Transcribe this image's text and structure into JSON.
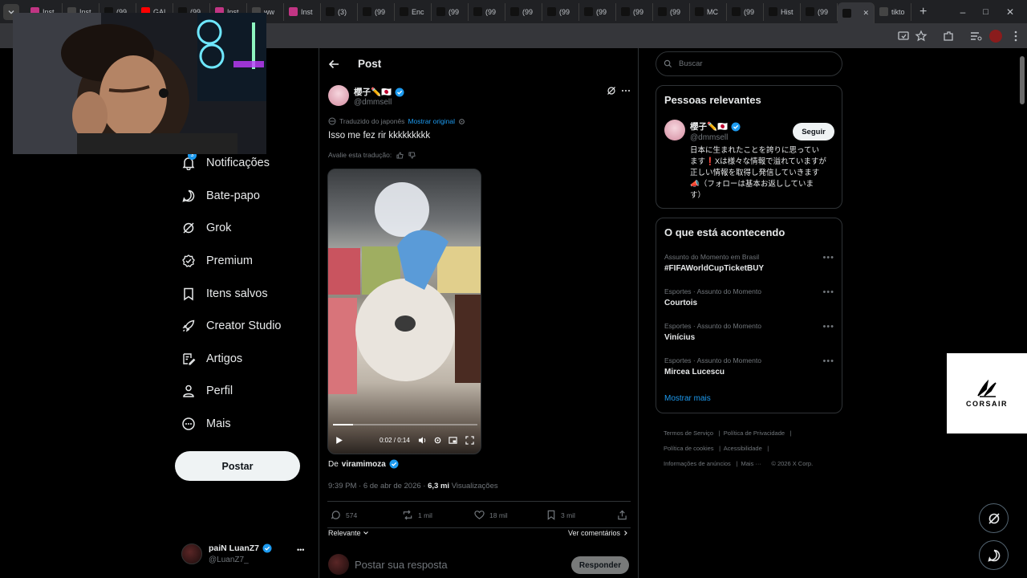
{
  "browser": {
    "tabs": [
      {
        "label": "Inst",
        "icon": "instagram-icon",
        "color": "#c13584"
      },
      {
        "label": "Inst",
        "icon": "threads-icon",
        "color": "#444"
      },
      {
        "label": "(99",
        "icon": "tiktok-icon",
        "color": "#111"
      },
      {
        "label": "GAL",
        "icon": "youtube-icon",
        "color": "#ff0000"
      },
      {
        "label": "(99",
        "icon": "tiktok-icon",
        "color": "#111"
      },
      {
        "label": "Inst",
        "icon": "instagram-icon",
        "color": "#c13584"
      },
      {
        "label": "ww",
        "icon": "globe-icon",
        "color": "#444"
      },
      {
        "label": "Inst",
        "icon": "instagram-icon",
        "color": "#c13584"
      },
      {
        "label": "(3)",
        "icon": "x-icon",
        "color": "#111"
      },
      {
        "label": "(99",
        "icon": "tiktok-icon",
        "color": "#111"
      },
      {
        "label": "Enc",
        "icon": "tiktok-icon",
        "color": "#111"
      },
      {
        "label": "(99",
        "icon": "tiktok-icon",
        "color": "#111"
      },
      {
        "label": "(99",
        "icon": "tiktok-icon",
        "color": "#111"
      },
      {
        "label": "(99",
        "icon": "tiktok-icon",
        "color": "#111"
      },
      {
        "label": "(99",
        "icon": "tiktok-icon",
        "color": "#111"
      },
      {
        "label": "(99",
        "icon": "tiktok-icon",
        "color": "#111"
      },
      {
        "label": "(99",
        "icon": "tiktok-icon",
        "color": "#111"
      },
      {
        "label": "(99",
        "icon": "tiktok-icon",
        "color": "#111"
      },
      {
        "label": "MC",
        "icon": "tiktok-icon",
        "color": "#111"
      },
      {
        "label": "(99",
        "icon": "tiktok-icon",
        "color": "#111"
      },
      {
        "label": "Hist",
        "icon": "tiktok-icon",
        "color": "#111"
      },
      {
        "label": "(99",
        "icon": "tiktok-icon",
        "color": "#111"
      },
      {
        "label": "",
        "icon": "x-icon",
        "color": "#111",
        "active": true
      },
      {
        "label": "tikto",
        "icon": "globe-icon",
        "color": "#444"
      }
    ],
    "new_tab": "+",
    "window_controls": [
      "–",
      "□",
      "✕"
    ]
  },
  "sidebar": {
    "notification_badge": "3",
    "items": [
      {
        "label": "Notificações",
        "icon": "bell-icon"
      },
      {
        "label": "Bate-papo",
        "icon": "chat-icon"
      },
      {
        "label": "Grok",
        "icon": "grok-icon"
      },
      {
        "label": "Premium",
        "icon": "premium-icon"
      },
      {
        "label": "Itens salvos",
        "icon": "bookmark-icon"
      },
      {
        "label": "Creator Studio",
        "icon": "rocket-icon"
      },
      {
        "label": "Artigos",
        "icon": "article-icon"
      },
      {
        "label": "Perfil",
        "icon": "person-icon"
      },
      {
        "label": "Mais",
        "icon": "more-circle-icon"
      }
    ],
    "post_button": "Postar",
    "account": {
      "name": "paiN LuanZ7",
      "handle": "@LuanZ7_",
      "more": "•••"
    }
  },
  "post": {
    "header_title": "Post",
    "author_name": "櫻子✏️🇯🇵",
    "author_handle": "@dmmsell",
    "translated_label": "Traduzido do japonês",
    "show_original": "Mostrar original",
    "text": "Isso me fez rir kkkkkkkkk",
    "rate_translation": "Avalie esta tradução:",
    "video": {
      "time": "0:02 / 0:14",
      "progress": 0.14
    },
    "from_label": "De",
    "from_user": "viramimoza",
    "timestamp": "9:39 PM · 6 de abr de 2026 ·",
    "views_count": "6,3 mi",
    "views_label": "Visualizações",
    "actions": {
      "replies": "574",
      "reposts": "1 mil",
      "likes": "18 mil",
      "bookmarks": "3 mil"
    },
    "sort_label": "Relevante",
    "see_comments": "Ver comentários",
    "reply_placeholder": "Postar sua resposta",
    "reply_button": "Responder"
  },
  "right": {
    "search_placeholder": "Buscar",
    "relevant_title": "Pessoas relevantes",
    "relevant_person": {
      "name": "櫻子✏️🇯🇵",
      "handle": "@dmmsell",
      "follow": "Seguir",
      "bio_1": "日本に生まれたことを誇りに思ってい",
      "bio_2": "ます❗️Xは様々な情報で溢れていますが",
      "bio_3": "正しい情報を取得し発信していきます",
      "bio_4": "📣（フォローは基本お返ししていま",
      "bio_5": "す）"
    },
    "trends_title": "O que está acontecendo",
    "trends": [
      {
        "category": "Assunto do Momento em Brasil",
        "name": "#FIFAWorldCupTicketBUY"
      },
      {
        "category": "Esportes · Assunto do Momento",
        "name": "Courtois"
      },
      {
        "category": "Esportes · Assunto do Momento",
        "name": "Vinícius"
      },
      {
        "category": "Esportes · Assunto do Momento",
        "name": "Mircea Lucescu"
      }
    ],
    "show_more": "Mostrar mais",
    "footer": {
      "terms": "Termos de Serviço",
      "privacy": "Política de Privacidade",
      "cookies": "Política de cookies",
      "accessibility": "Acessibilidade",
      "ads": "Informações de anúncios",
      "more": "Mais ···",
      "copyright": "© 2026 X Corp."
    }
  },
  "ad": {
    "brand": "CORSAIR"
  },
  "colors": {
    "accent": "#1d9bf0",
    "background": "#000000",
    "border": "#2f3336",
    "muted": "#71767b"
  }
}
